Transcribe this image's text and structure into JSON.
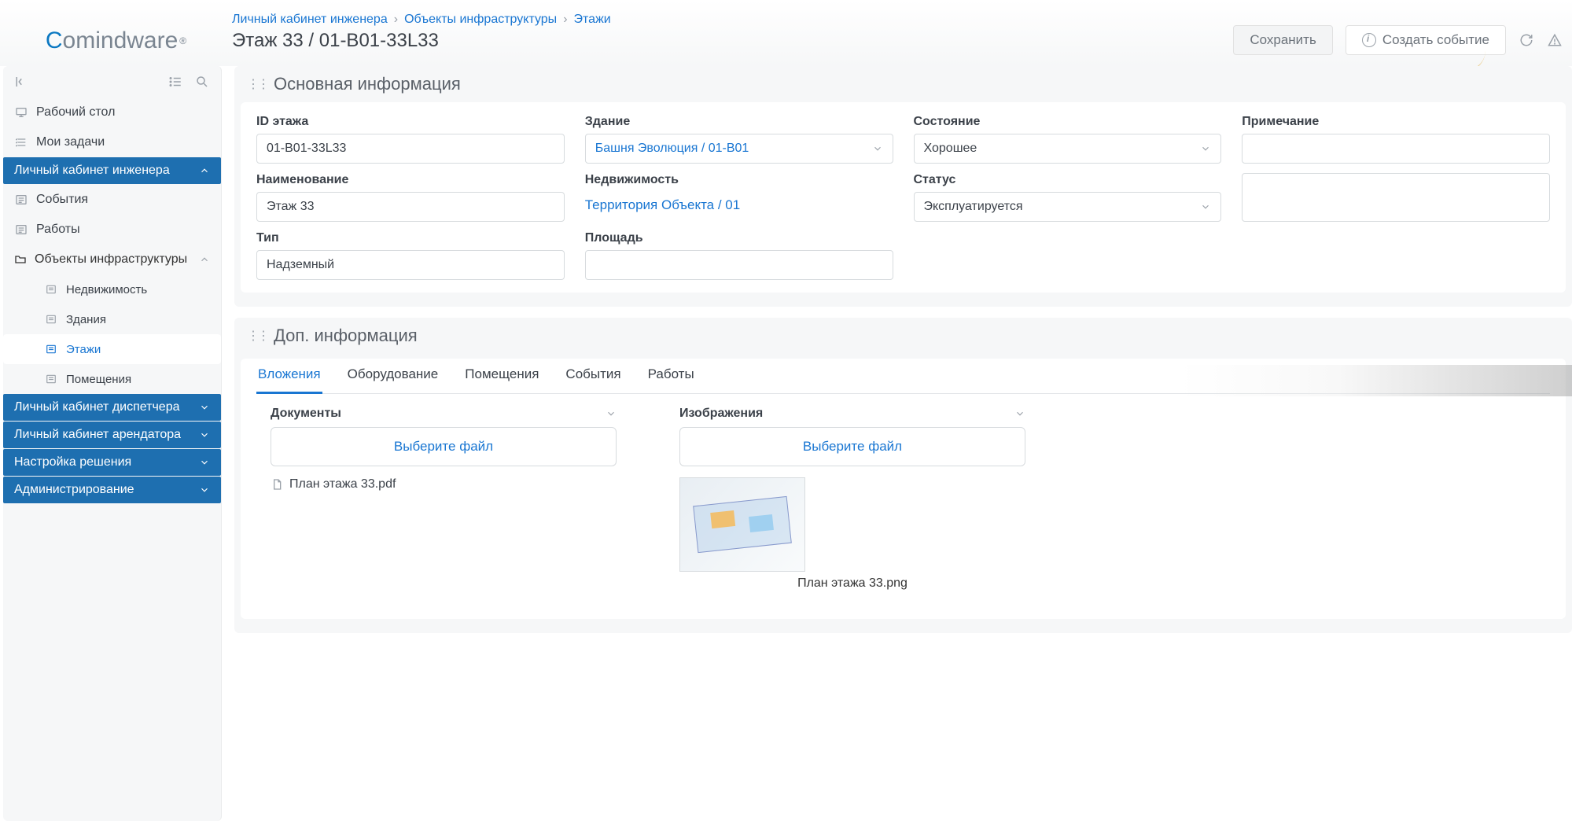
{
  "logo": {
    "c": "C",
    "rest": "omindware",
    "reg": "®"
  },
  "breadcrumb": [
    {
      "label": "Личный кабинет инженера"
    },
    {
      "label": "Объекты инфраструктуры"
    },
    {
      "label": "Этажи"
    }
  ],
  "page_title": "Этаж 33 / 01-B01-33L33",
  "actions": {
    "save": "Сохранить",
    "create_event": "Создать событие"
  },
  "sidebar": {
    "items": [
      {
        "label": "Рабочий стол",
        "icon": "desktop"
      },
      {
        "label": "Мои задачи",
        "icon": "tasks"
      }
    ],
    "section_engineer": {
      "label": "Личный кабинет инженера",
      "children": [
        {
          "label": "События",
          "icon": "list"
        },
        {
          "label": "Работы",
          "icon": "list"
        }
      ],
      "infra": {
        "label": "Объекты инфраструктуры",
        "children": [
          {
            "label": "Недвижимость"
          },
          {
            "label": "Здания"
          },
          {
            "label": "Этажи",
            "active": true
          },
          {
            "label": "Помещения"
          }
        ]
      }
    },
    "other_sections": [
      {
        "label": "Личный кабинет диспетчера"
      },
      {
        "label": "Личный кабинет арендатора"
      },
      {
        "label": "Настройка решения"
      },
      {
        "label": "Администрирование"
      }
    ]
  },
  "panel_main": {
    "title": "Основная информация",
    "fields": {
      "id": {
        "label": "ID этажа",
        "value": "01-B01-33L33"
      },
      "building": {
        "label": "Здание",
        "value": "Башня Эволюция / 01-B01"
      },
      "condition": {
        "label": "Состояние",
        "value": "Хорошее"
      },
      "note": {
        "label": "Примечание",
        "value": ""
      },
      "name": {
        "label": "Наименование",
        "value": "Этаж 33"
      },
      "realestate": {
        "label": "Недвижимость",
        "value": "Территория Объекта / 01"
      },
      "status": {
        "label": "Статус",
        "value": "Эксплуатируется"
      },
      "type": {
        "label": "Тип",
        "value": "Надземный"
      },
      "area": {
        "label": "Площадь",
        "value": ""
      }
    }
  },
  "panel_extra": {
    "title": "Доп. информация",
    "tabs": [
      "Вложения",
      "Оборудование",
      "Помещения",
      "События",
      "Работы"
    ],
    "documents": {
      "title": "Документы",
      "choose": "Выберите файл",
      "file": "План этажа 33.pdf"
    },
    "images": {
      "title": "Изображения",
      "choose": "Выберите файл",
      "file": "План этажа 33.png"
    }
  }
}
